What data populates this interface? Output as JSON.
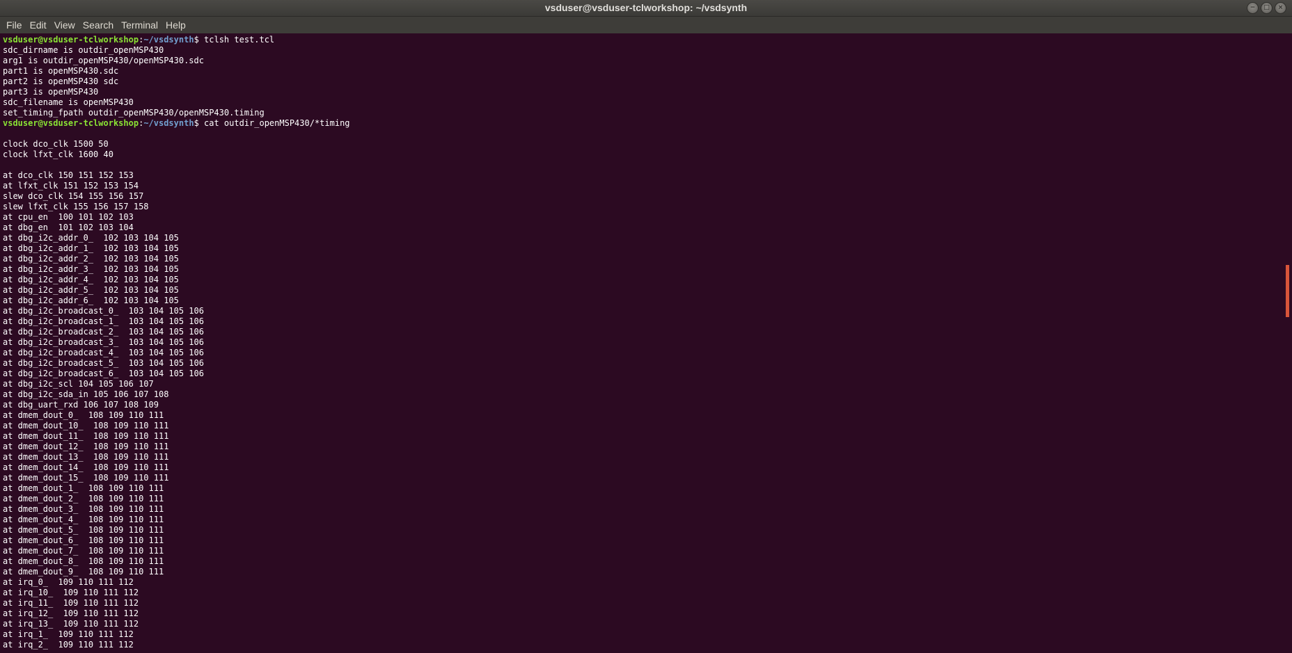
{
  "window": {
    "title": "vsduser@vsduser-tclworkshop: ~/vsdsynth",
    "buttons": {
      "minimize": "−",
      "maximize": "□",
      "close": "×"
    }
  },
  "menubar": {
    "items": [
      "File",
      "Edit",
      "View",
      "Search",
      "Terminal",
      "Help"
    ]
  },
  "terminal": {
    "colors": {
      "background": "#2c0a22",
      "prompt_user": "#8ae234",
      "prompt_path": "#729fcf",
      "text": "#ffffff",
      "scroll_indicator": "#d9553a"
    },
    "prompt": {
      "user_host": "vsduser@vsduser-tclworkshop",
      "separator": ":",
      "path": "~/vsdsynth",
      "symbol": "$ "
    },
    "lines": [
      {
        "prompt": true,
        "text": "tclsh test.tcl"
      },
      {
        "text": "sdc_dirname is outdir_openMSP430"
      },
      {
        "text": "arg1 is outdir_openMSP430/openMSP430.sdc"
      },
      {
        "text": "part1 is openMSP430.sdc"
      },
      {
        "text": "part2 is openMSP430 sdc"
      },
      {
        "text": "part3 is openMSP430"
      },
      {
        "text": "sdc_filename is openMSP430"
      },
      {
        "text": "set_timing_fpath outdir_openMSP430/openMSP430.timing"
      },
      {
        "prompt": true,
        "text": "cat outdir_openMSP430/*timing"
      },
      {
        "text": ""
      },
      {
        "text": "clock dco_clk 1500 50"
      },
      {
        "text": "clock lfxt_clk 1600 40"
      },
      {
        "text": ""
      },
      {
        "text": "at dco_clk 150 151 152 153"
      },
      {
        "text": "at lfxt_clk 151 152 153 154"
      },
      {
        "text": "slew dco_clk 154 155 156 157"
      },
      {
        "text": "slew lfxt_clk 155 156 157 158"
      },
      {
        "text": "at cpu_en  100 101 102 103"
      },
      {
        "text": "at dbg_en  101 102 103 104"
      },
      {
        "text": "at dbg_i2c_addr_0_  102 103 104 105"
      },
      {
        "text": "at dbg_i2c_addr_1_  102 103 104 105"
      },
      {
        "text": "at dbg_i2c_addr_2_  102 103 104 105"
      },
      {
        "text": "at dbg_i2c_addr_3_  102 103 104 105"
      },
      {
        "text": "at dbg_i2c_addr_4_  102 103 104 105"
      },
      {
        "text": "at dbg_i2c_addr_5_  102 103 104 105"
      },
      {
        "text": "at dbg_i2c_addr_6_  102 103 104 105"
      },
      {
        "text": "at dbg_i2c_broadcast_0_  103 104 105 106"
      },
      {
        "text": "at dbg_i2c_broadcast_1_  103 104 105 106"
      },
      {
        "text": "at dbg_i2c_broadcast_2_  103 104 105 106"
      },
      {
        "text": "at dbg_i2c_broadcast_3_  103 104 105 106"
      },
      {
        "text": "at dbg_i2c_broadcast_4_  103 104 105 106"
      },
      {
        "text": "at dbg_i2c_broadcast_5_  103 104 105 106"
      },
      {
        "text": "at dbg_i2c_broadcast_6_  103 104 105 106"
      },
      {
        "text": "at dbg_i2c_scl 104 105 106 107"
      },
      {
        "text": "at dbg_i2c_sda_in 105 106 107 108"
      },
      {
        "text": "at dbg_uart_rxd 106 107 108 109"
      },
      {
        "text": "at dmem_dout_0_  108 109 110 111"
      },
      {
        "text": "at dmem_dout_10_  108 109 110 111"
      },
      {
        "text": "at dmem_dout_11_  108 109 110 111"
      },
      {
        "text": "at dmem_dout_12_  108 109 110 111"
      },
      {
        "text": "at dmem_dout_13_  108 109 110 111"
      },
      {
        "text": "at dmem_dout_14_  108 109 110 111"
      },
      {
        "text": "at dmem_dout_15_  108 109 110 111"
      },
      {
        "text": "at dmem_dout_1_  108 109 110 111"
      },
      {
        "text": "at dmem_dout_2_  108 109 110 111"
      },
      {
        "text": "at dmem_dout_3_  108 109 110 111"
      },
      {
        "text": "at dmem_dout_4_  108 109 110 111"
      },
      {
        "text": "at dmem_dout_5_  108 109 110 111"
      },
      {
        "text": "at dmem_dout_6_  108 109 110 111"
      },
      {
        "text": "at dmem_dout_7_  108 109 110 111"
      },
      {
        "text": "at dmem_dout_8_  108 109 110 111"
      },
      {
        "text": "at dmem_dout_9_  108 109 110 111"
      },
      {
        "text": "at irq_0_  109 110 111 112"
      },
      {
        "text": "at irq_10_  109 110 111 112"
      },
      {
        "text": "at irq_11_  109 110 111 112"
      },
      {
        "text": "at irq_12_  109 110 111 112"
      },
      {
        "text": "at irq_13_  109 110 111 112"
      },
      {
        "text": "at irq_1_  109 110 111 112"
      },
      {
        "text": "at irq_2_  109 110 111 112"
      }
    ]
  }
}
